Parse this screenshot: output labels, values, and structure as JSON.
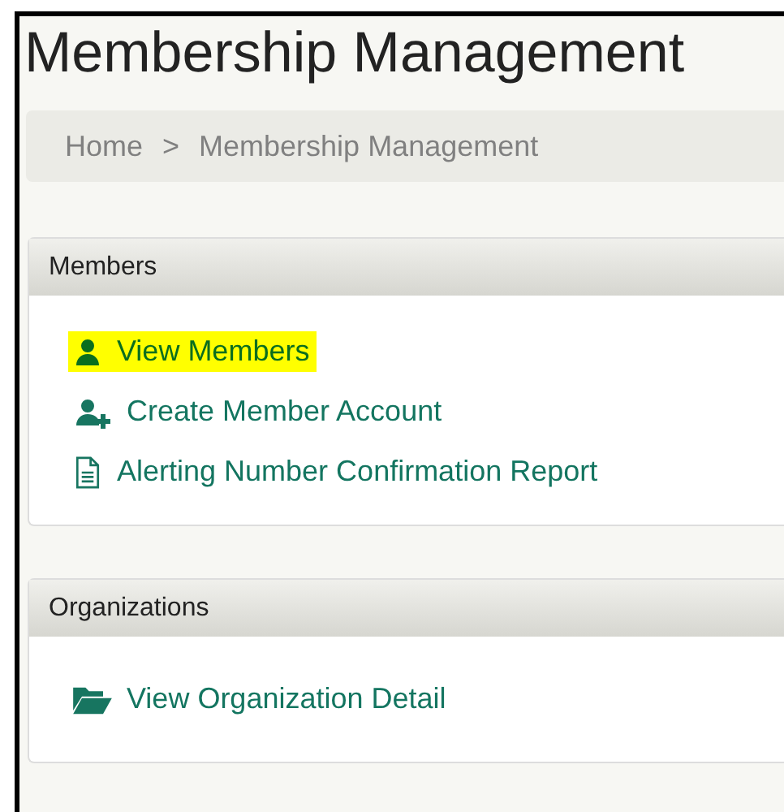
{
  "page": {
    "title": "Membership Management"
  },
  "breadcrumb": [
    {
      "label": "Home"
    },
    {
      "label": ">"
    },
    {
      "label": "Membership Management"
    }
  ],
  "panels": [
    {
      "title": "Members",
      "links": [
        {
          "label": "View Members",
          "kind": "user",
          "highlighted": true
        },
        {
          "label": "Create Member Account",
          "kind": "user-plus",
          "highlighted": false
        },
        {
          "label": "Alerting Number Confirmation Report",
          "kind": "document",
          "highlighted": false
        }
      ]
    },
    {
      "title": "Organizations",
      "links": [
        {
          "label": "View Organization Detail",
          "kind": "folder",
          "highlighted": false
        }
      ]
    }
  ]
}
